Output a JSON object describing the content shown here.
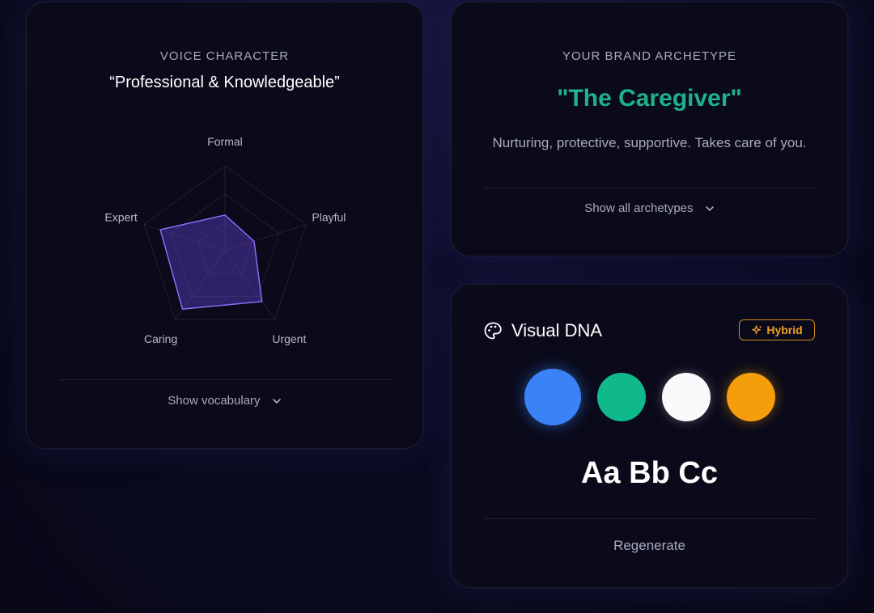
{
  "voice": {
    "overline": "VOICE CHARACTER",
    "quote": "“Professional & Knowledgeable”",
    "radar": {
      "axes": [
        "Formal",
        "Playful",
        "Urgent",
        "Caring",
        "Expert"
      ],
      "values": [
        0.42,
        0.36,
        0.74,
        0.85,
        0.8
      ]
    },
    "toggle_label": "Show vocabulary",
    "accent": "#7b5cf0"
  },
  "archetype": {
    "overline": "YOUR BRAND ARCHETYPE",
    "name": "\"The Caregiver\"",
    "description": "Nurturing, protective, supportive. Takes care of you.",
    "toggle_label": "Show all archetypes",
    "accent": "#1fb28a"
  },
  "visual_dna": {
    "title": "Visual DNA",
    "icon": "palette-icon",
    "badge": "Hybrid",
    "badge_icon": "sparkle-icon",
    "colors": [
      "#3b82f6",
      "#10b98a",
      "#f8fafc",
      "#f59e0b"
    ],
    "type_sample": "Aa Bb Cc",
    "regenerate_label": "Regenerate"
  }
}
